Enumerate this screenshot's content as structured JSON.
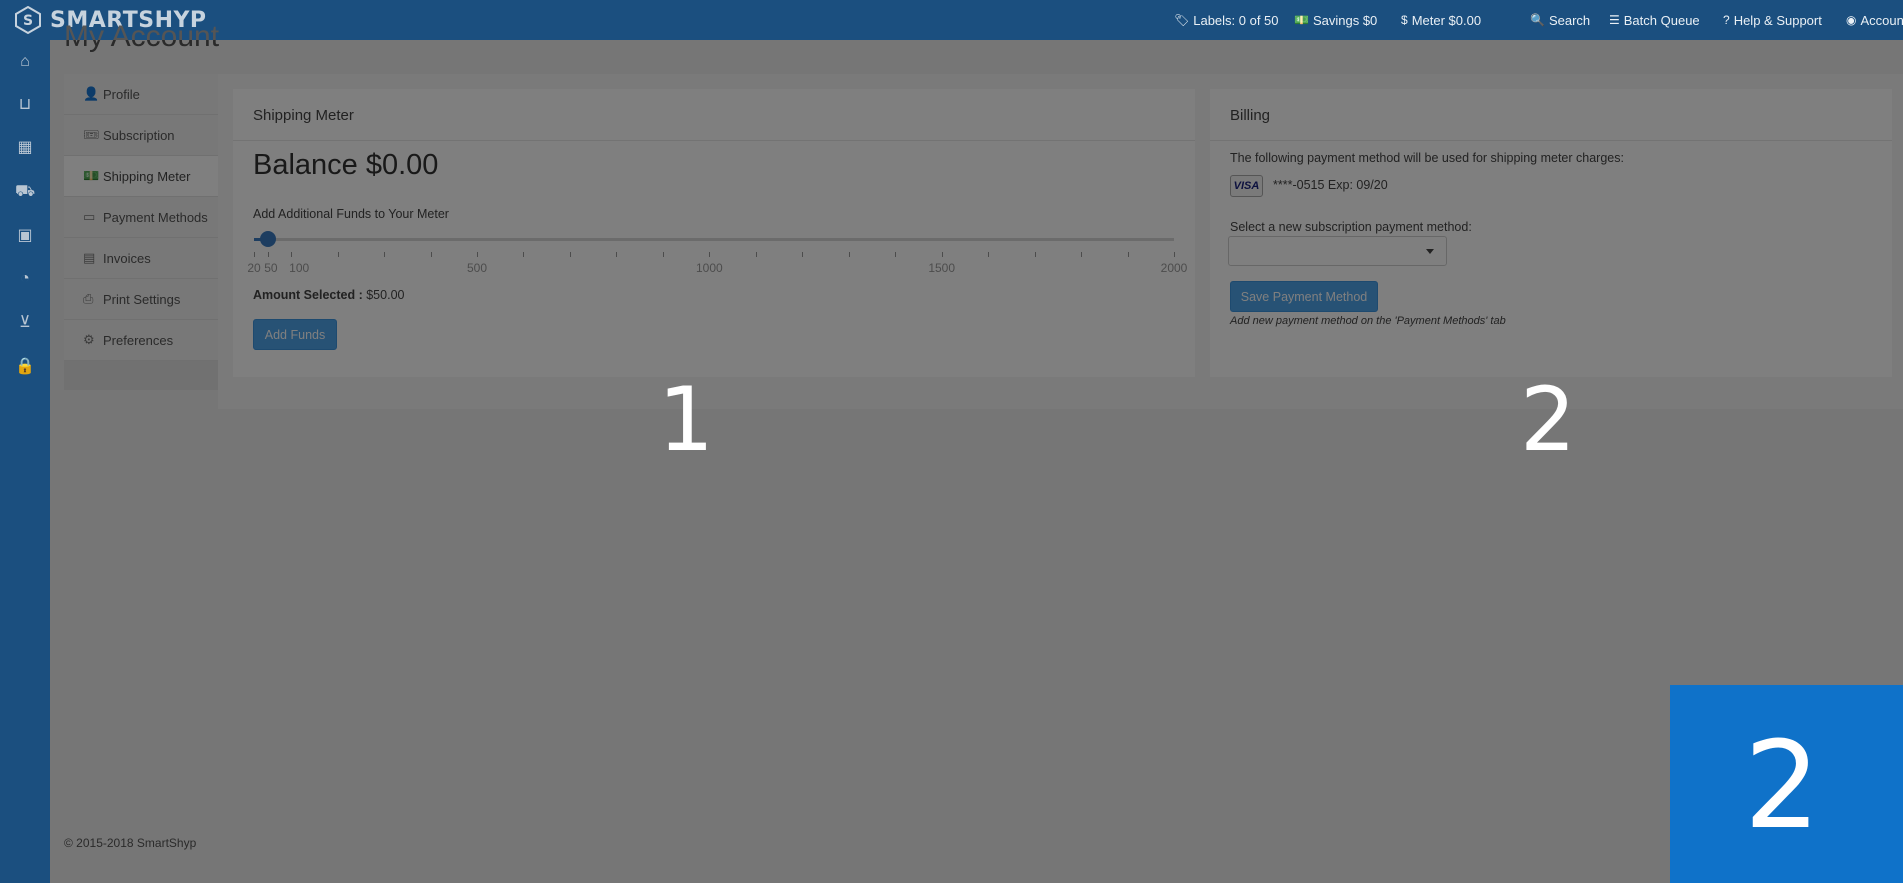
{
  "brand": {
    "smart": "SMART",
    "shyp": "SHYP"
  },
  "topnav": {
    "labels": "Labels: 0 of 50",
    "savings": "Savings $0",
    "meter": "Meter $0.00",
    "search": "Search",
    "batch_queue": "Batch Queue",
    "help": "Help & Support",
    "account": "Account"
  },
  "sidebar": {
    "icons": [
      "home-icon",
      "basket-icon",
      "calendar-icon",
      "truck-icon",
      "address-book-icon",
      "pie-chart-icon",
      "cart-icon",
      "lock-icon"
    ]
  },
  "page": {
    "title": "My Account"
  },
  "tabs": [
    {
      "label": "Profile",
      "icon": "user-icon"
    },
    {
      "label": "Subscription",
      "icon": "ticket-icon"
    },
    {
      "label": "Shipping Meter",
      "icon": "money-icon"
    },
    {
      "label": "Payment Methods",
      "icon": "credit-card-icon"
    },
    {
      "label": "Invoices",
      "icon": "file-icon"
    },
    {
      "label": "Print Settings",
      "icon": "printer-icon"
    },
    {
      "label": "Preferences",
      "icon": "gears-icon"
    }
  ],
  "active_tab": "Shipping Meter",
  "meter_panel": {
    "heading": "Shipping Meter",
    "balance": "Balance $0.00",
    "add_label": "Add Additional Funds to Your Meter",
    "slider": {
      "min": 20,
      "max": 2000,
      "value": 50,
      "tick_labels": [
        "20",
        "50",
        "100",
        "500",
        "1000",
        "1500",
        "2000"
      ]
    },
    "amount_label": "Amount Selected :",
    "amount_value": "$50.00",
    "add_button": "Add Funds"
  },
  "billing_panel": {
    "heading": "Billing",
    "description": "The following payment method will be used for shipping meter charges:",
    "card_brand": "VISA",
    "card_text": "****-0515 Exp: 09/20",
    "select_label": "Select a new subscription payment method:",
    "select_value": "",
    "save_button": "Save Payment Method",
    "note": "Add new payment method on the 'Payment Methods' tab"
  },
  "footer": {
    "copyright": "© 2015-2018 SmartShyp"
  },
  "overlay_labels": {
    "panel1": "1",
    "panel2": "2",
    "corner": "2"
  },
  "colors": {
    "topbar": "#1b4f7f",
    "accent": "#4fa4ea",
    "badge": "#0f72c9"
  }
}
